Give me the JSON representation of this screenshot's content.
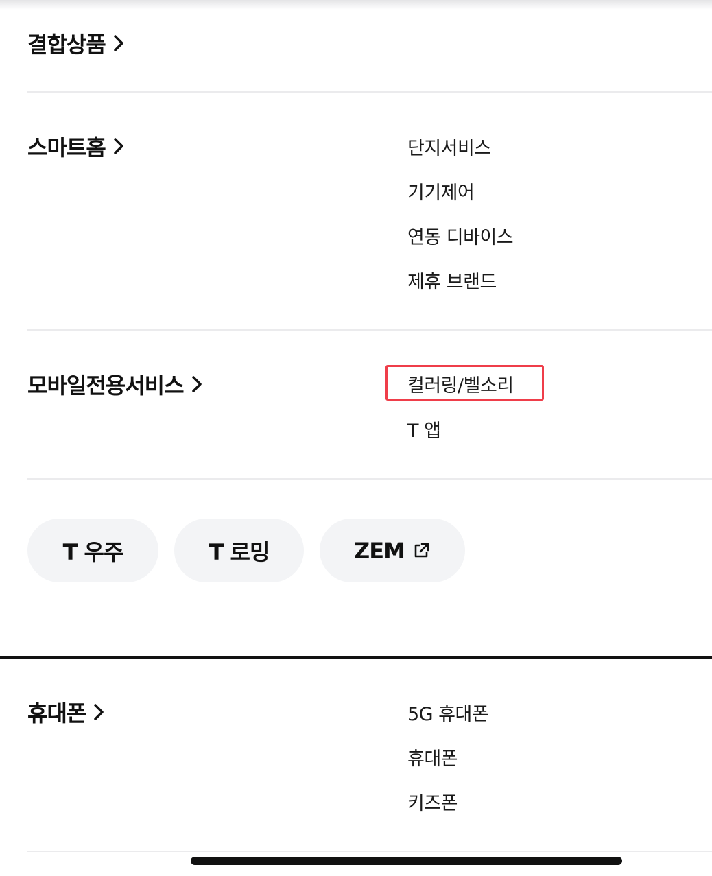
{
  "categories": [
    {
      "title": "결합상품",
      "items": []
    },
    {
      "title": "스마트홈",
      "items": [
        "단지서비스",
        "기기제어",
        "연동 디바이스",
        "제휴 브랜드"
      ]
    },
    {
      "title": "모바일전용서비스",
      "items": [
        "컬러링/벨소리",
        "T 앱"
      ]
    },
    {
      "title": "휴대폰",
      "items": [
        "5G 휴대폰",
        "휴대폰",
        "키즈폰"
      ]
    }
  ],
  "quick_links": [
    {
      "label": "T 우주",
      "external": false
    },
    {
      "label": "T 로밍",
      "external": false
    },
    {
      "label": "ZEM",
      "external": true,
      "icon": "external-link-icon"
    }
  ],
  "highlighted_item": "컬러링/벨소리",
  "colors": {
    "highlight": "#ef3e4a",
    "pill_bg": "#f3f4f6",
    "divider": "#ebebed",
    "text": "#111111"
  }
}
